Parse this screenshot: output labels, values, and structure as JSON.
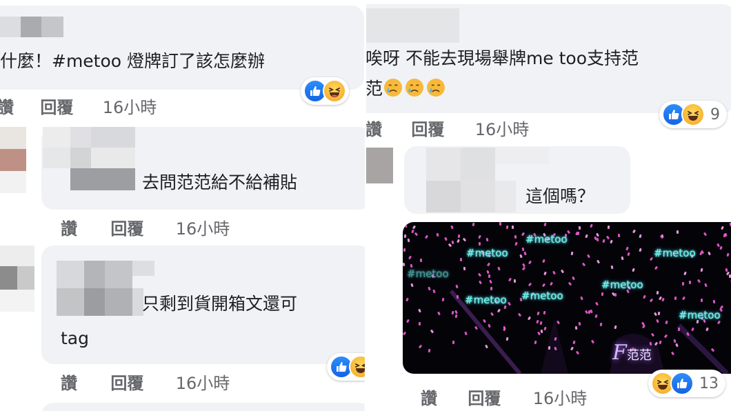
{
  "left_column": {
    "comments": [
      {
        "text": "什麼！#metoo 燈牌訂了該怎麼辦",
        "actions": {
          "like": "讚",
          "reply": "回覆",
          "time": "16小時"
        }
      },
      {
        "text": "去問范范給不給補貼",
        "actions": {
          "like": "讚",
          "reply": "回覆",
          "time": "16小時"
        }
      },
      {
        "text_line1": "只剩到貨開箱文還可",
        "text_line2": "tag",
        "actions": {
          "like": "讚",
          "reply": "回覆",
          "time": "16小時"
        }
      }
    ]
  },
  "right_column": {
    "comments": [
      {
        "text_line1": "唉呀 不能去現場舉牌me too支持范",
        "text_line2": "范",
        "reaction_count": "9",
        "actions": {
          "like": "讚",
          "reply": "回覆",
          "time": "16小時"
        }
      },
      {
        "text": "這個嗎？",
        "video_tags": [
          "#metoo",
          "#metoo",
          "#metoo",
          "#metoo",
          "#metoo",
          "#metoo",
          "#metoo",
          "#metoo"
        ],
        "video_logo": "范范",
        "reaction_count": "13",
        "actions": {
          "like": "讚",
          "reply": "回覆",
          "time": "16小時"
        }
      }
    ]
  },
  "icons": {
    "like": "like-reaction-icon",
    "haha": "haha-reaction-icon",
    "sad": "crying-face-emoji"
  },
  "colors": {
    "bubble": "#f0f2f5",
    "meta": "#65676b",
    "like_blue": "#1877f2",
    "neon_cyan": "#6ff5e6",
    "neon_pink": "#ee5fd7"
  }
}
